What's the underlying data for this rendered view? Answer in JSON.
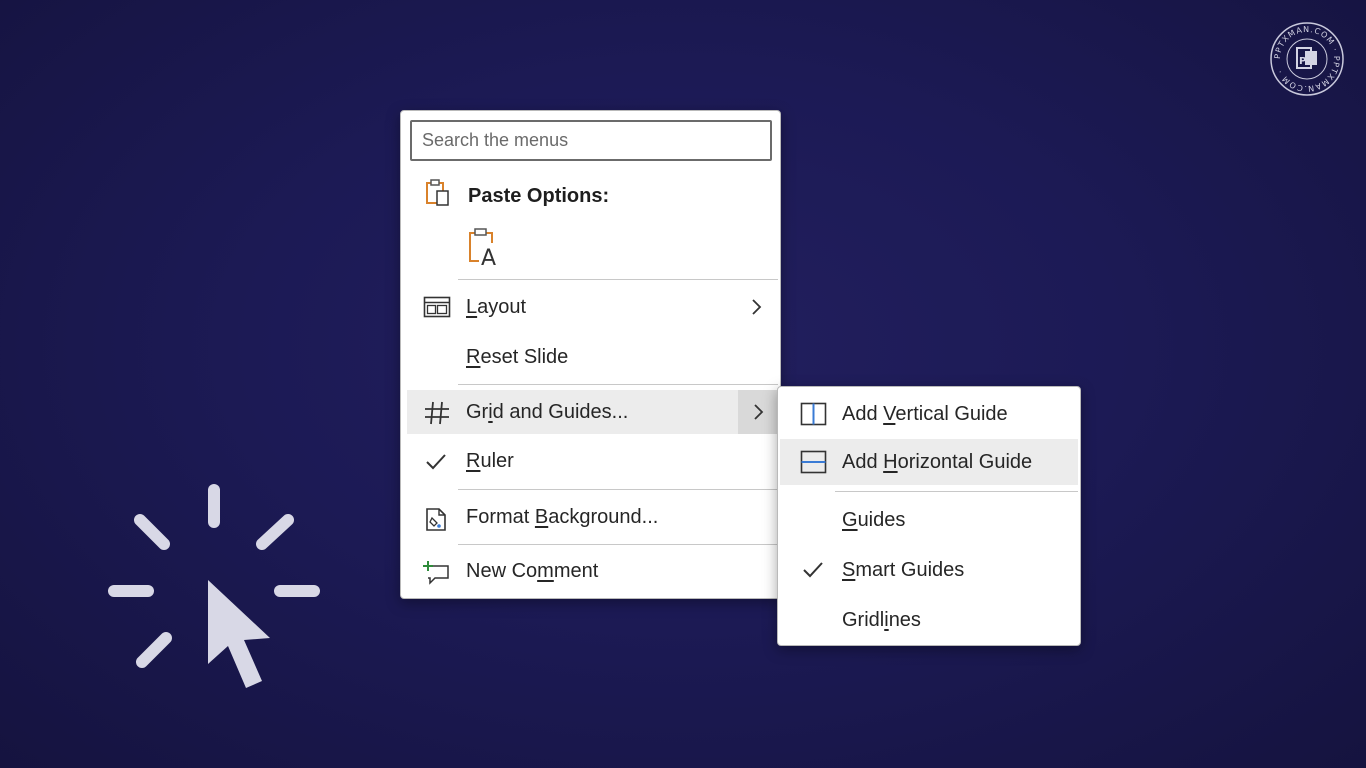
{
  "context_menu": {
    "search_placeholder": "Search the menus",
    "paste_options_label": "Paste Options:",
    "items": [
      {
        "label_pre": "",
        "label_key": "L",
        "label_post": "ayout"
      },
      {
        "label_pre": "",
        "label_key": "R",
        "label_post": "eset Slide"
      },
      {
        "label_pre": "Gr",
        "label_key": "i",
        "label_post": "d and Guides..."
      },
      {
        "label_pre": "",
        "label_key": "R",
        "label_post": "uler"
      },
      {
        "label_pre": "Format ",
        "label_key": "B",
        "label_post": "ackground..."
      },
      {
        "label_pre": "New Co",
        "label_key": "m",
        "label_post": "ment"
      }
    ]
  },
  "submenu": {
    "items": [
      {
        "label_pre": "Add ",
        "label_key": "V",
        "label_post": "ertical Guide"
      },
      {
        "label_pre": "Add ",
        "label_key": "H",
        "label_post": "orizontal Guide"
      },
      {
        "label_pre": "",
        "label_key": "G",
        "label_post": "uides"
      },
      {
        "label_pre": "",
        "label_key": "S",
        "label_post": "mart Guides"
      },
      {
        "label_pre": "Gridl",
        "label_key": "i",
        "label_post": "nes"
      }
    ]
  },
  "watermark": {
    "text": "PPTXMAN.COM · PPTXMAN.COM ·"
  },
  "colors": {
    "background": "#1c1a55",
    "accent_orange": "#d9822b",
    "accent_green": "#2e8b3a",
    "highlight": "#ececec"
  }
}
